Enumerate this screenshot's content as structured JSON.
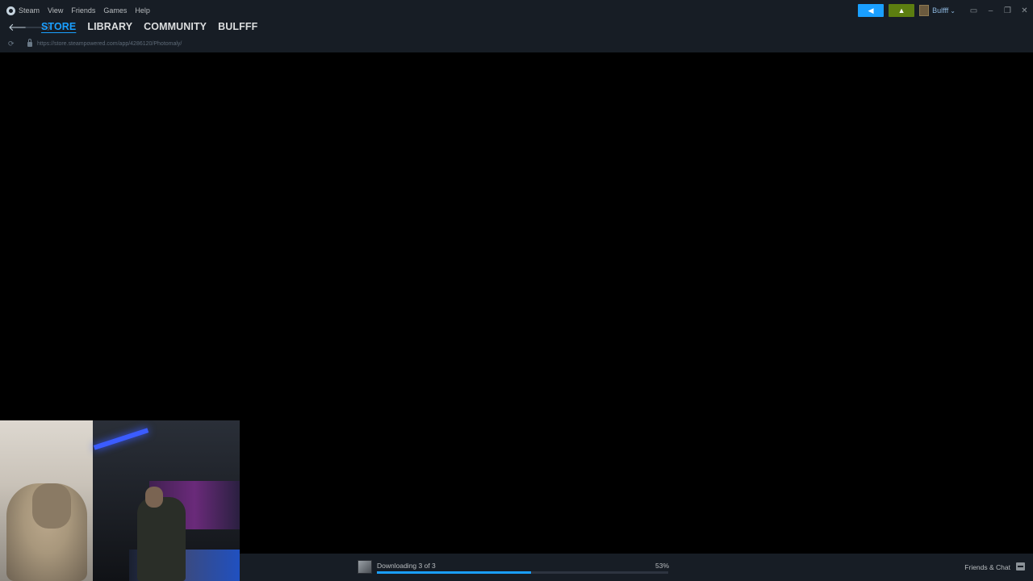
{
  "menu": {
    "items": [
      "Steam",
      "View",
      "Friends",
      "Games",
      "Help"
    ]
  },
  "titlebar": {
    "announce_icon": "megaphone-icon",
    "notif_icon": "bell-icon",
    "username": "Bulfff",
    "user_chevron": "⌄",
    "colors": {
      "announce": "#1a9fff",
      "notifications": "#5c7e10",
      "accent": "#1a9fff"
    }
  },
  "nav": {
    "back": "🡐",
    "forward": "🡒",
    "tabs": [
      "STORE",
      "LIBRARY",
      "COMMUNITY",
      "BULFFF"
    ],
    "active_tab": "STORE",
    "url": "https://store.steampowered.com/app/4286120/Photomaly/"
  },
  "downloads": {
    "label": "Downloading 3 of 3",
    "percent": "53%",
    "progress_fraction": 0.53
  },
  "friends": {
    "label": "Friends & Chat"
  }
}
